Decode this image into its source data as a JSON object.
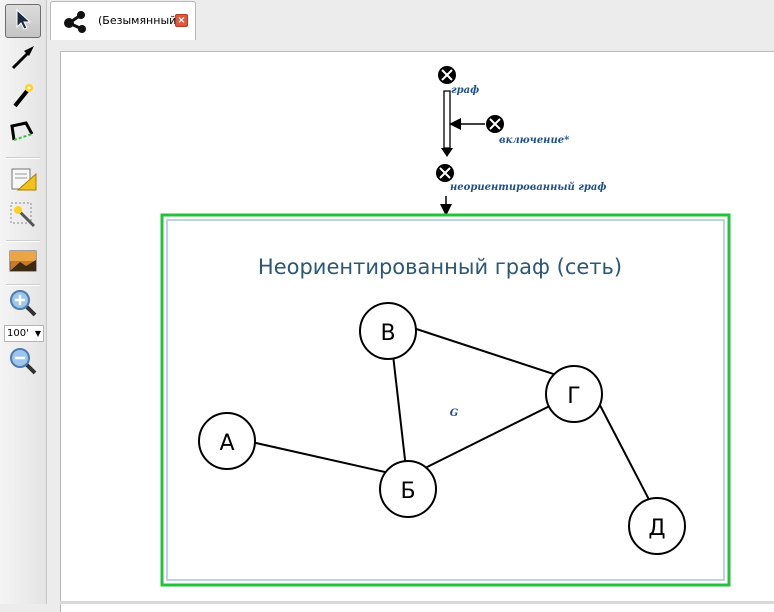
{
  "tab": {
    "title": "(Безымянный)"
  },
  "toolbar": {
    "zoom_value": "100'"
  },
  "diagram": {
    "labels": {
      "graph": "граф",
      "inclusion": "включение*",
      "undirected": "неориентированный граф"
    },
    "frame_title": "Неориентированный граф (сеть)",
    "center_label": "G",
    "nodes": {
      "A": "А",
      "B": "Б",
      "V": "В",
      "G": "Г",
      "D": "Д"
    },
    "colors": {
      "frame": "#22c33a",
      "title": "#2b5876",
      "label": "#1d4f8f"
    }
  }
}
